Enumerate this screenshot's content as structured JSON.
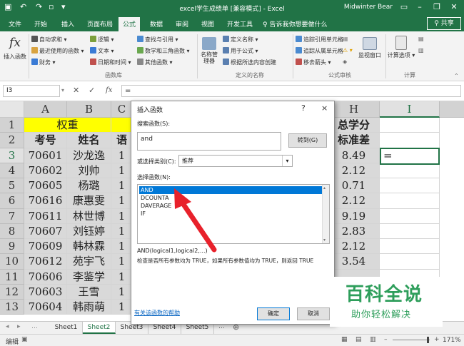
{
  "app": {
    "window_title": "excel学生成绩单 [兼容模式] - Excel",
    "user": "Midwinter Bear",
    "share_label": "共享",
    "tell_me": "告诉我你想要做什么"
  },
  "ribbon_tabs": [
    "文件",
    "开始",
    "插入",
    "页面布局",
    "公式",
    "数据",
    "审阅",
    "视图",
    "开发工具"
  ],
  "active_tab": "公式",
  "ribbon": {
    "insert_function": "插入函数",
    "function_library": {
      "items": [
        "自动求和",
        "最近使用的函数",
        "财务",
        "逻辑",
        "文本",
        "日期和时间",
        "查找与引用",
        "数学和三角函数",
        "其他函数"
      ],
      "group_label": "函数库"
    },
    "name_manager": "名称管理器",
    "defined_names": {
      "items": [
        "定义名称",
        "用于公式",
        "根据所选内容创建"
      ],
      "group_label": "定义的名称"
    },
    "formula_auditing": {
      "items": [
        "追踪引用单元格",
        "追踪从属单元格",
        "移去箭头"
      ],
      "group_label": "公式审核"
    },
    "watch_window": "监视窗口",
    "calc_options": "计算选项",
    "calc_group": "计算"
  },
  "formula_bar": {
    "name_box": "I3",
    "formula": "="
  },
  "columns": [
    "A",
    "B",
    "C",
    "H",
    "I"
  ],
  "rows": [
    "1",
    "2",
    "3",
    "4",
    "5",
    "6",
    "7",
    "8",
    "9",
    "10",
    "11",
    "12",
    "13"
  ],
  "sheet": {
    "r1_a": "权重",
    "h_header_line1": "总学分",
    "h_header_line2": "标准差",
    "r2_a": "考号",
    "r2_b": "姓名",
    "r2_c": "语",
    "data_rows": [
      {
        "id": "70601",
        "name": "沙龙逸",
        "c": "1",
        "h": "8.49"
      },
      {
        "id": "70602",
        "name": "刘帅",
        "c": "1",
        "h": "2.12"
      },
      {
        "id": "70605",
        "name": "杨璐",
        "c": "1",
        "h": "0.71"
      },
      {
        "id": "70616",
        "name": "康惠雯",
        "c": "1",
        "h": "2.12"
      },
      {
        "id": "70611",
        "name": "林世博",
        "c": "1",
        "h": "9.19"
      },
      {
        "id": "70607",
        "name": "刘钰婷",
        "c": "1",
        "h": "2.83"
      },
      {
        "id": "70609",
        "name": "韩林霖",
        "c": "1",
        "h": "2.12"
      },
      {
        "id": "70612",
        "name": "苑宇飞",
        "c": "1",
        "h": "3.54"
      },
      {
        "id": "70606",
        "name": "李鉴学",
        "c": "1",
        "h": ""
      },
      {
        "id": "70603",
        "name": "王雪",
        "c": "1",
        "h": ""
      },
      {
        "id": "70604",
        "name": "韩雨萌",
        "c": "1",
        "h": ""
      }
    ],
    "active_cell_value": "="
  },
  "sheet_tabs": [
    "Sheet1",
    "Sheet2",
    "Sheet3",
    "Sheet4",
    "Sheet5"
  ],
  "active_sheet": "Sheet2",
  "status": {
    "mode": "编辑",
    "zoom": "171%"
  },
  "dialog": {
    "title": "插入函数",
    "help_btn": "?",
    "close_btn": "×",
    "search_label": "搜索函数(S):",
    "search_value": "and",
    "goto_label": "转到(G)",
    "category_label": "或选择类别(C):",
    "category_value": "推荐",
    "select_label": "选择函数(N):",
    "functions": [
      "AND",
      "DCOUNTA",
      "DAVERAGE",
      "IF"
    ],
    "selected_function": "AND",
    "signature": "AND(logical1,logical2,...)",
    "description": "检查是否所有参数均为 TRUE，如果所有参数值均为 TRUE，则返回 TRUE",
    "help_link": "有关该函数的帮助",
    "ok_label": "确定",
    "cancel_label": "取消"
  },
  "watermark": {
    "line1": "百科全说",
    "line2": "助你轻松解决"
  },
  "colors": {
    "excel_green": "#217346",
    "highlight_yellow": "#ffff00",
    "selection_blue": "#0078d7",
    "arrow_red": "#e8212b",
    "watermark_green": "#2e9e5b"
  }
}
